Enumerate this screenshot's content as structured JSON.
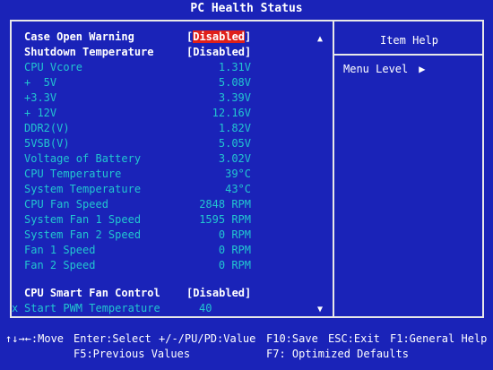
{
  "title": "PC Health Status",
  "help": {
    "title": "Item Help",
    "menu_level": "Menu Level",
    "arrow": "▶"
  },
  "items": [
    {
      "label": "Case Open Warning",
      "value": "[Disabled]",
      "kind": "sel",
      "highlight": true
    },
    {
      "label": "Shutdown Temperature",
      "value": "[Disabled]",
      "kind": "sel"
    },
    {
      "label": "CPU Vcore",
      "value": "1.31V",
      "kind": "ro"
    },
    {
      "label": "+  5V",
      "value": "5.08V",
      "kind": "ro"
    },
    {
      "label": "+3.3V",
      "value": "3.39V",
      "kind": "ro"
    },
    {
      "label": "+ 12V",
      "value": "12.16V",
      "kind": "ro"
    },
    {
      "label": "DDR2(V)",
      "value": "1.82V",
      "kind": "ro"
    },
    {
      "label": "5VSB(V)",
      "value": "5.05V",
      "kind": "ro"
    },
    {
      "label": "Voltage of Battery",
      "value": "3.02V",
      "kind": "ro"
    },
    {
      "label": "CPU Temperature",
      "value": "39°C",
      "kind": "ro"
    },
    {
      "label": "System Temperature",
      "value": "43°C",
      "kind": "ro"
    },
    {
      "label": "CPU Fan Speed",
      "value": "2848 RPM",
      "kind": "ro"
    },
    {
      "label": "System Fan 1 Speed",
      "value": "1595 RPM",
      "kind": "ro"
    },
    {
      "label": "System Fan 2 Speed",
      "value": "0 RPM",
      "kind": "ro"
    },
    {
      "label": "Fan 1 Speed",
      "value": "0 RPM",
      "kind": "ro"
    },
    {
      "label": "Fan 2 Speed",
      "value": "0 RPM",
      "kind": "ro"
    }
  ],
  "smart_fan": {
    "label": "CPU Smart Fan Control",
    "value": "[Disabled]"
  },
  "pwm": {
    "marker": "x",
    "label": "Start PWM Temperature",
    "value": "40"
  },
  "scroll": {
    "up": "▲",
    "down": "▼"
  },
  "footer": {
    "move": "↑↓→←:Move",
    "enter": "Enter:Select",
    "value": "+/-/PU/PD:Value",
    "save": "F10:Save",
    "exit": "ESC:Exit",
    "help": "F1:General Help",
    "prev": "F5:Previous Values",
    "defaults": "F7: Optimized Defaults"
  }
}
